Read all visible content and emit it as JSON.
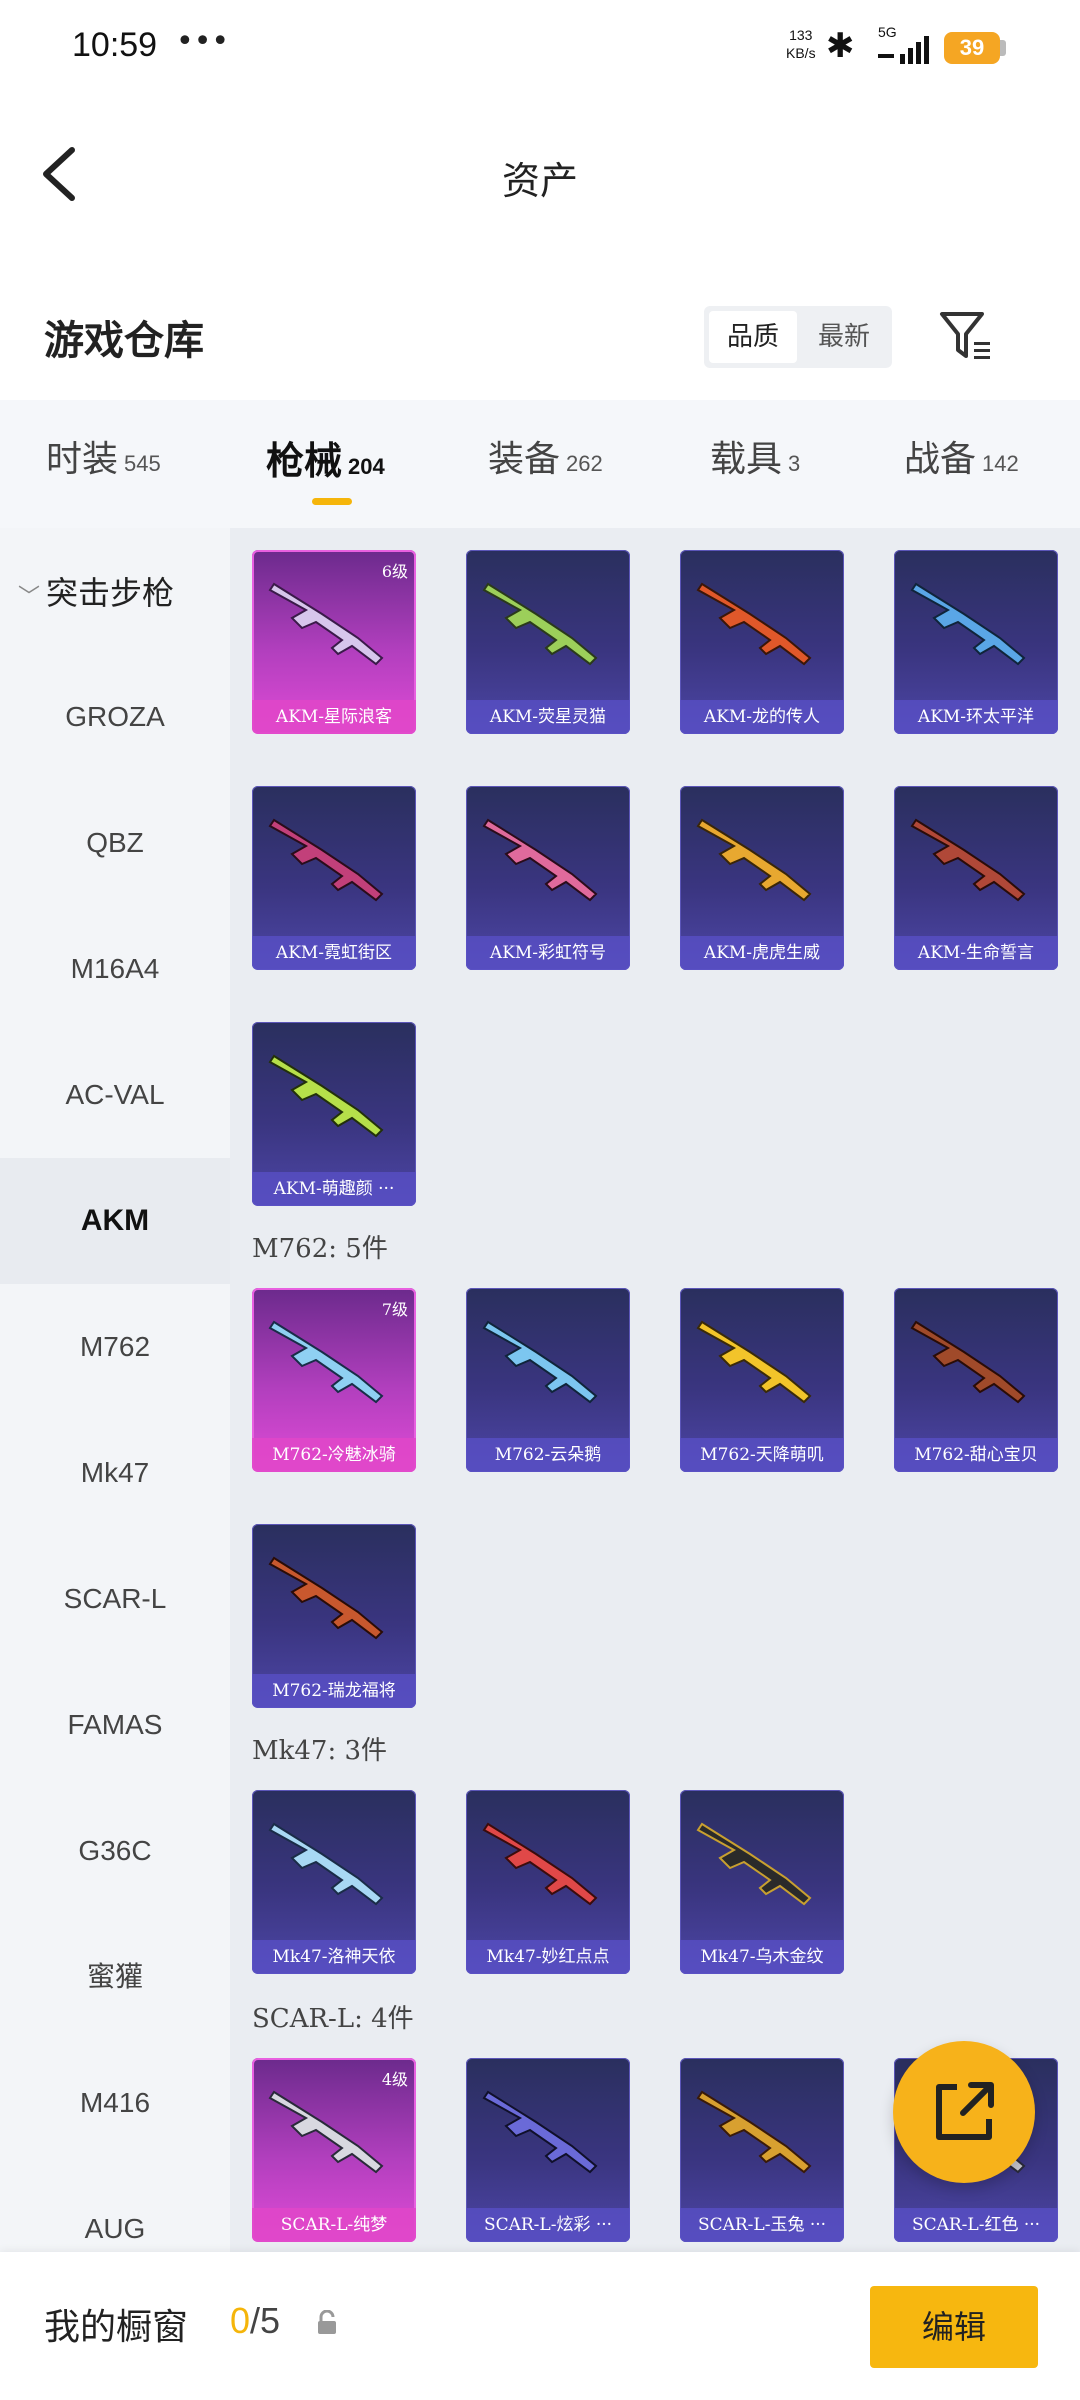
{
  "status": {
    "time": "10:59",
    "dots": "•••",
    "net_speed": "133",
    "net_unit": "KB/s",
    "net_type": "5G",
    "battery": "39",
    "battery_color": "#f5a623"
  },
  "header": {
    "title": "资产"
  },
  "section": {
    "title": "游戏仓库",
    "sort_options": [
      "品质",
      "最新"
    ]
  },
  "tabs": [
    {
      "label": "时装",
      "count": "545"
    },
    {
      "label": "枪械",
      "count": "204"
    },
    {
      "label": "装备",
      "count": "262"
    },
    {
      "label": "载具",
      "count": "3"
    },
    {
      "label": "战备",
      "count": "142"
    }
  ],
  "sidebar": {
    "group": "突击步枪",
    "items": [
      "GROZA",
      "QBZ",
      "M16A4",
      "AC-VAL",
      "AKM",
      "M762",
      "Mk47",
      "SCAR-L",
      "FAMAS",
      "G36C",
      "蜜獾",
      "M416",
      "AUG"
    ]
  },
  "groups": {
    "m762": "M762: 5件",
    "mk47": "Mk47: 3件",
    "scarl": "SCAR-L: 4件"
  },
  "cards": {
    "akm": [
      {
        "name": "AKM-星际浪客",
        "level": "6级"
      },
      {
        "name": "AKM-荧星灵猫"
      },
      {
        "name": "AKM-龙的传人"
      },
      {
        "name": "AKM-环太平洋"
      },
      {
        "name": "AKM-霓虹街区"
      },
      {
        "name": "AKM-彩虹符号"
      },
      {
        "name": "AKM-虎虎生威"
      },
      {
        "name": "AKM-生命誓言"
      },
      {
        "name": "AKM-萌趣颜 ···"
      }
    ],
    "m762": [
      {
        "name": "M762-冷魅冰骑",
        "level": "7级"
      },
      {
        "name": "M762-云朵鹅"
      },
      {
        "name": "M762-天降萌叽"
      },
      {
        "name": "M762-甜心宝贝"
      },
      {
        "name": "M762-瑞龙福将"
      }
    ],
    "mk47": [
      {
        "name": "Mk47-洛神天依"
      },
      {
        "name": "Mk47-妙红点点"
      },
      {
        "name": "Mk47-乌木金纹"
      }
    ],
    "scarl": [
      {
        "name": "SCAR-L-纯梦",
        "level": "4级"
      },
      {
        "name": "SCAR-L-炫彩 ···"
      },
      {
        "name": "SCAR-L-玉兔 ···"
      },
      {
        "name": "SCAR-L-红色 ···"
      }
    ]
  },
  "bottom": {
    "title": "我的橱窗",
    "used": "0",
    "total": "/5",
    "edit_label": "编辑"
  },
  "colors": {
    "accent": "#f5b50a",
    "card_purple": "#3a3580",
    "card_pink": "#b23fbe"
  }
}
